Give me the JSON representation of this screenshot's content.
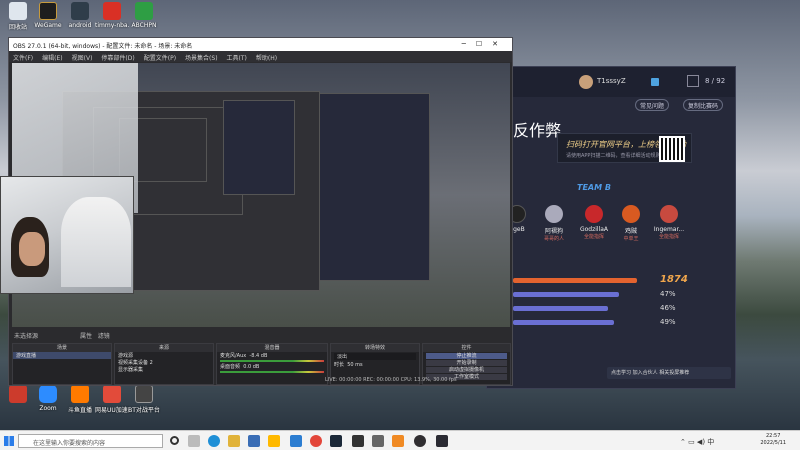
{
  "desktop": {
    "icons": [
      {
        "label": "回收站",
        "color": "#dfe6ee"
      },
      {
        "label": "WeGame",
        "color": "#1e1e1e"
      },
      {
        "label": "android",
        "color": "#2f3d4a"
      },
      {
        "label": "timmy-nba...",
        "color": "#d93025"
      },
      {
        "label": "ABCHPN",
        "color": "#2e9e44"
      },
      {
        "label": "",
        "color": "#cc3b2c"
      },
      {
        "label": "Zoom",
        "color": "#2d8cff"
      },
      {
        "label": "斗鱼直播",
        "color": "#ff7a00"
      },
      {
        "label": "网易UU加速器",
        "color": "#e24b3a"
      },
      {
        "label": "BT对战平台",
        "color": "#444"
      }
    ]
  },
  "client": {
    "username": "T1sssyZ",
    "count": "8 / 92",
    "pill_left": "常见问题",
    "pill_right": "复制比赛码",
    "heading": "反作弊",
    "banner_title": "扫码打开官网平台，上榜领取奖励",
    "banner_sub": "请使用APP扫描二维码，查看详细活动规则",
    "team_label": "TEAM B",
    "players": [
      {
        "name": "ngeB",
        "tag": "",
        "color": "#222"
      },
      {
        "name": "阿褶狗",
        "tag": "哥哥的人",
        "color": "#aab"
      },
      {
        "name": "GodzillaA",
        "tag": "全能指挥",
        "color": "#c8282b"
      },
      {
        "name": "鸡贼",
        "tag": "中单王",
        "color": "#d85a21"
      },
      {
        "name": "Ingemar...",
        "tag": "全能指挥",
        "color": "#c84a3f"
      }
    ],
    "bars": [
      {
        "value": "1874",
        "frac": 0.55,
        "color": "#e4632f",
        "big": true
      },
      {
        "value": "47%",
        "frac": 0.47,
        "color": "#6a6fd3",
        "big": false
      },
      {
        "value": "46%",
        "frac": 0.42,
        "color": "#6a6fd3",
        "big": false
      },
      {
        "value": "49%",
        "frac": 0.45,
        "color": "#6a6fd3",
        "big": false
      }
    ],
    "bottom_left": "点击学习",
    "bottom_mid": "加入合伙人",
    "bottom_right": "相关投屏推荐"
  },
  "obs": {
    "title": "OBS 27.0.1 (64-bit, windows) - 配置文件: 未命名 - 场景: 未命名",
    "menu": [
      "文件(F)",
      "编辑(E)",
      "视图(V)",
      "停靠部件(D)",
      "配置文件(P)",
      "场景集合(S)",
      "工具(T)",
      "帮助(H)"
    ],
    "dock_tabs": [
      "未选择源",
      "属性",
      "滤镜"
    ],
    "panels": {
      "scenes": {
        "header": "场景",
        "items": [
          "游戏直播"
        ]
      },
      "sources": {
        "header": "来源",
        "items": [
          "游戏源",
          "框",
          "视频采集设备 2",
          "视频采集设备",
          "显示器采集",
          "视频"
        ]
      },
      "mixer": {
        "header": "混音器",
        "ch1": "麦克风/Aux",
        "ch2": "桌面音频",
        "db1": "-8.4 dB",
        "db2": "0.0 dB"
      },
      "transitions": {
        "header": "转场特效",
        "type": "淡出",
        "duration_label": "时长",
        "duration": "50 ms"
      },
      "controls": {
        "header": "控件",
        "buttons": [
          "停止推流",
          "开始录制",
          "启动虚拟摄像机",
          "工作室模式",
          "设置",
          "退出"
        ]
      }
    },
    "status": "LIVE: 00:00:00   REC: 00:00:00   CPU: 13.9%, 30.00 fps"
  },
  "taskbar": {
    "search_placeholder": "在这里输入你要搜索的内容",
    "time": "22:57",
    "date": "2022/5/11"
  }
}
